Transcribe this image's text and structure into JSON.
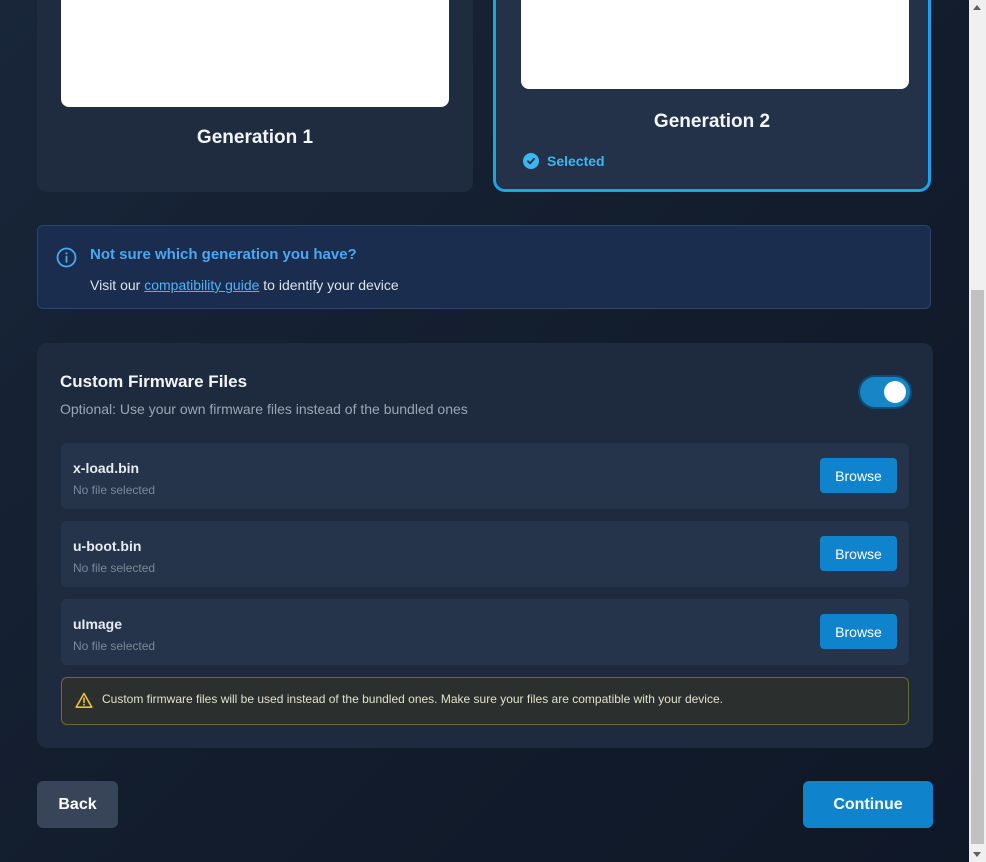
{
  "generations": [
    {
      "title": "Generation 1",
      "selected": false
    },
    {
      "title": "Generation 2",
      "selected": true,
      "selected_label": "Selected"
    }
  ],
  "info": {
    "heading": "Not sure which generation you have?",
    "prefix": "Visit our ",
    "link": "compatibility guide",
    "suffix": " to identify your device"
  },
  "firmware": {
    "heading": "Custom Firmware Files",
    "subtitle": "Optional: Use your own firmware files instead of the bundled ones",
    "toggle_on": true,
    "files": [
      {
        "name": "x-load.bin",
        "status": "No file selected",
        "button": "Browse"
      },
      {
        "name": "u-boot.bin",
        "status": "No file selected",
        "button": "Browse"
      },
      {
        "name": "uImage",
        "status": "No file selected",
        "button": "Browse"
      }
    ],
    "warning": "Custom firmware files will be used instead of the bundled ones. Make sure your files are compatible with your device."
  },
  "nav": {
    "back": "Back",
    "continue": "Continue"
  },
  "colors": {
    "accent": "#1aa4e6",
    "button": "#0f84cc",
    "info_heading": "#4aa8f2",
    "warning_border": "#6f6734"
  }
}
